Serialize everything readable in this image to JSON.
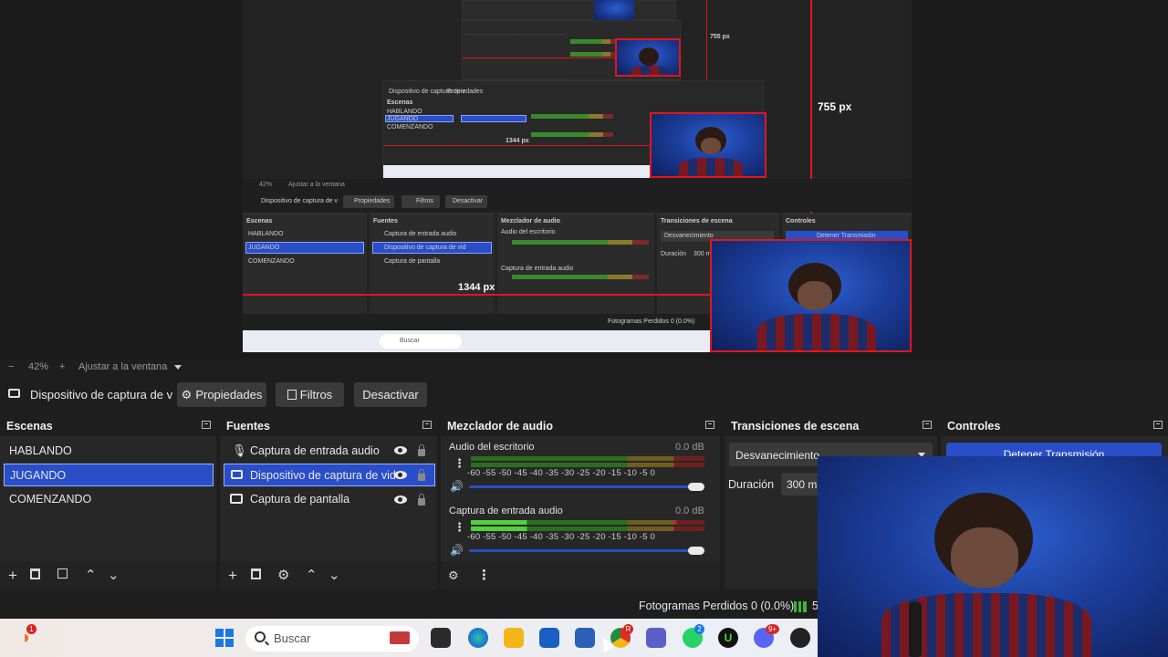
{
  "colors": {
    "accent": "#2a4ec8",
    "guide_red": "#e0161e",
    "panel": "#272727",
    "background": "#1e1e1e"
  },
  "preview": {
    "px_label_horizontal": "1344 px",
    "px_label_vertical": "755 px",
    "nested_horizontal_label": "1344 px",
    "nested_vertical_label": "755 px",
    "nested_zoom": "42%",
    "nested_fit": "Ajustar a la ventana",
    "nested_source": "Dispositivo de captura de v",
    "nested_props": "Propiedades",
    "nested_filters": "Filtros",
    "nested_deactivate": "Desactivar",
    "nested_scenes_title": "Escenas",
    "nested_sources_title": "Fuentes",
    "nested_mixer_title": "Mezclador de audio",
    "nested_transitions_title": "Transiciones de escena",
    "nested_controls_title": "Controles",
    "nested_scene_1": "HABLANDO",
    "nested_scene_2": "JUGANDO",
    "nested_scene_3": "COMENZANDO",
    "nested_source_1": "Captura de entrada audio",
    "nested_source_2": "Dispositivo de captura de vid",
    "nested_source_3": "Captura de pantalla",
    "nested_mix_1": "Audio del escritorio",
    "nested_mix_2": "Captura de entrada audio",
    "nested_transition": "Desvanecimiento",
    "nested_duration": "Duración",
    "nested_duration_value": "300 m",
    "nested_stop": "Detener Transmisión",
    "nested_frames": "Fotogramas Perdidos 0 (0.0%)",
    "nested_search": "Buscar"
  },
  "zoombar": {
    "minus": "−",
    "zoom": "42%",
    "plus": "+",
    "fit": "Ajustar a la ventana"
  },
  "source_toolbar": {
    "source_name": "Dispositivo de captura de v",
    "properties": "Propiedades",
    "filters": "Filtros",
    "deactivate": "Desactivar"
  },
  "scenes": {
    "title": "Escenas",
    "items": [
      {
        "label": "HABLANDO",
        "selected": false
      },
      {
        "label": "JUGANDO",
        "selected": true
      },
      {
        "label": "COMENZANDO",
        "selected": false
      }
    ]
  },
  "sources": {
    "title": "Fuentes",
    "items": [
      {
        "label": "Captura de entrada audio",
        "icon": "microphone-icon",
        "selected": false
      },
      {
        "label": "Dispositivo de captura de vide",
        "icon": "camera-icon",
        "selected": true
      },
      {
        "label": "Captura de pantalla",
        "icon": "monitor-icon",
        "selected": false
      }
    ]
  },
  "mixer": {
    "title": "Mezclador de audio",
    "scale": "-60  -55  -50  -45  -40  -35  -30  -25  -20  -15  -10   -5    0",
    "channels": [
      {
        "label": "Audio del escritorio",
        "db": "0.0 dB",
        "level": 0
      },
      {
        "label": "Captura de entrada audio",
        "db": "0.0 dB",
        "level": 0.24
      }
    ]
  },
  "transitions": {
    "title": "Transiciones de escena",
    "selected": "Desvanecimiento",
    "duration_label": "Duración",
    "duration_value": "300 m"
  },
  "controls": {
    "title": "Controles",
    "stop_stream": "Detener Transmisión"
  },
  "status": {
    "frames_dropped": "Fotogramas Perdidos 0 (0.0%)",
    "trailing": "5"
  },
  "taskbar": {
    "search_placeholder": "Buscar",
    "badge_1": "1",
    "badge_2": "2",
    "badge_3": "9+",
    "badge_r": "R"
  }
}
